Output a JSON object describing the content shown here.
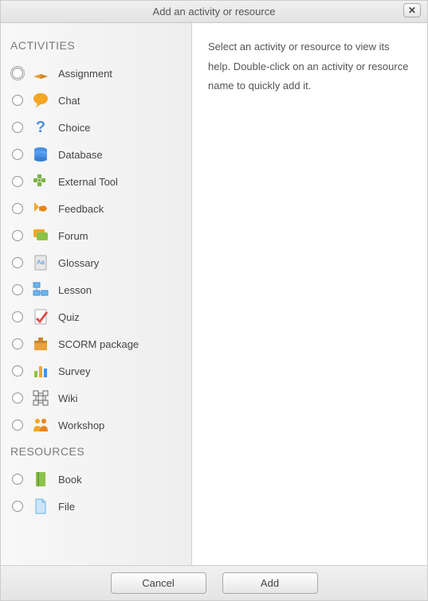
{
  "dialog": {
    "title": "Add an activity or resource",
    "close_label": "✕"
  },
  "help_text": "Select an activity or resource to view its help. Double-click on an activity or resource name to quickly add it.",
  "sections": {
    "activities_label": "ACTIVITIES",
    "resources_label": "RESOURCES"
  },
  "activities": [
    {
      "label": "Assignment",
      "icon": "assignment-icon"
    },
    {
      "label": "Chat",
      "icon": "chat-icon"
    },
    {
      "label": "Choice",
      "icon": "choice-icon"
    },
    {
      "label": "Database",
      "icon": "database-icon"
    },
    {
      "label": "External Tool",
      "icon": "external-tool-icon"
    },
    {
      "label": "Feedback",
      "icon": "feedback-icon"
    },
    {
      "label": "Forum",
      "icon": "forum-icon"
    },
    {
      "label": "Glossary",
      "icon": "glossary-icon"
    },
    {
      "label": "Lesson",
      "icon": "lesson-icon"
    },
    {
      "label": "Quiz",
      "icon": "quiz-icon"
    },
    {
      "label": "SCORM package",
      "icon": "scorm-icon"
    },
    {
      "label": "Survey",
      "icon": "survey-icon"
    },
    {
      "label": "Wiki",
      "icon": "wiki-icon"
    },
    {
      "label": "Workshop",
      "icon": "workshop-icon"
    }
  ],
  "resources": [
    {
      "label": "Book",
      "icon": "book-icon"
    },
    {
      "label": "File",
      "icon": "file-icon"
    }
  ],
  "footer": {
    "add_label": "Add",
    "cancel_label": "Cancel"
  }
}
